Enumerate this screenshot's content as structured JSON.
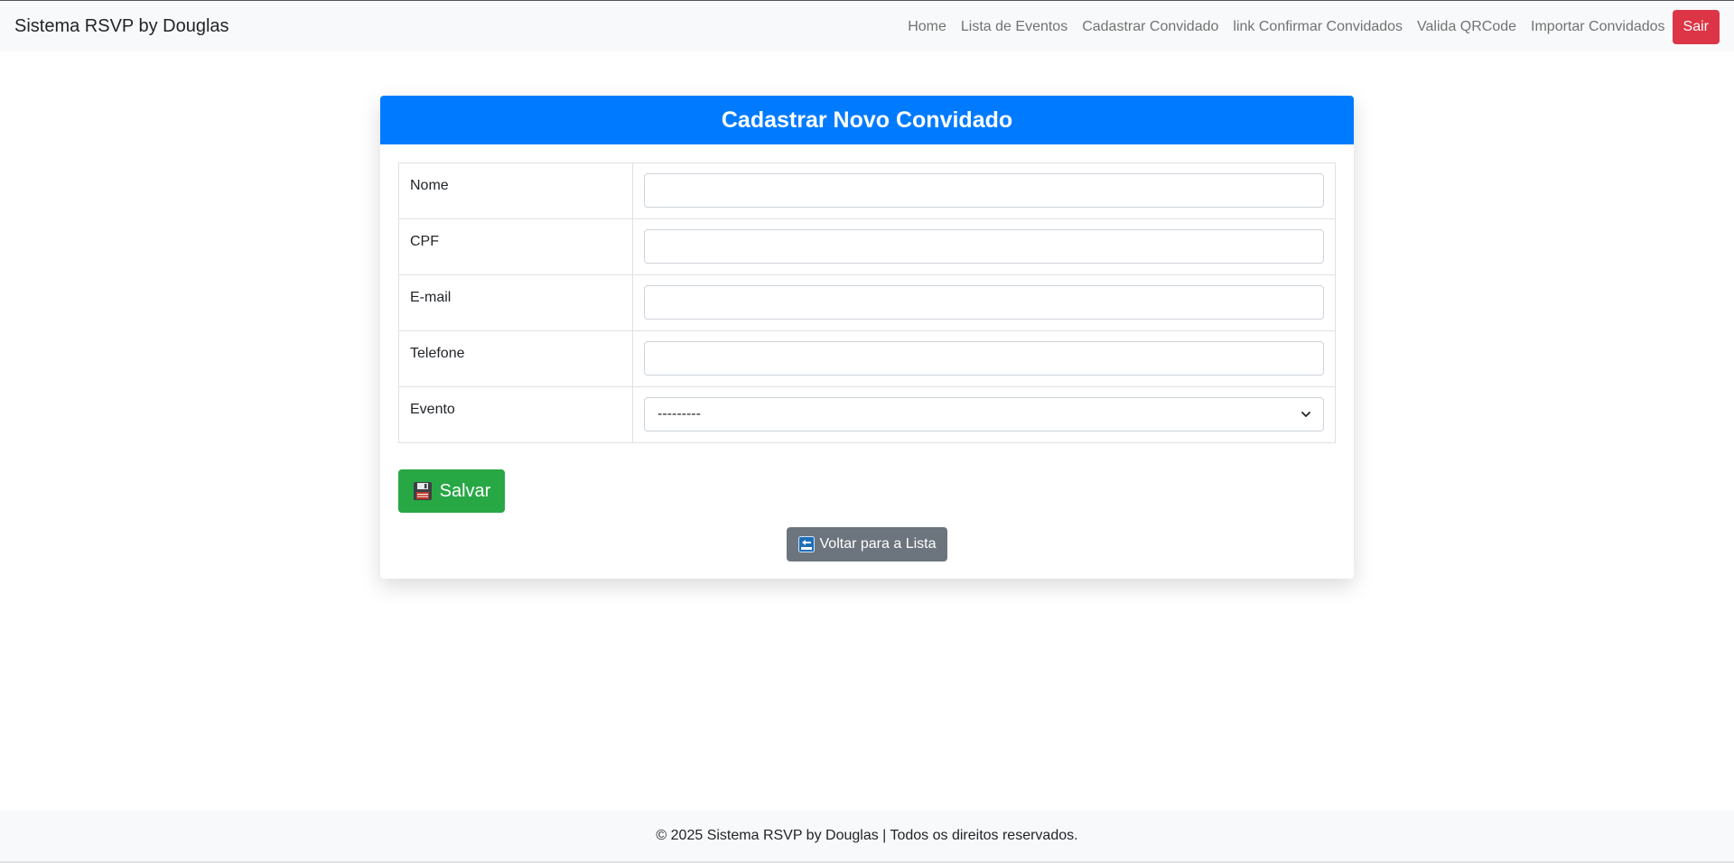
{
  "navbar": {
    "brand": "Sistema RSVP by Douglas",
    "links": [
      "Home",
      "Lista de Eventos",
      "Cadastrar Convidado",
      "link Confirmar Convidados",
      "Valida QRCode",
      "Importar Convidados"
    ],
    "logout": "Sair"
  },
  "form": {
    "title": "Cadastrar Novo Convidado",
    "fields": [
      {
        "label": "Nome",
        "value": ""
      },
      {
        "label": "CPF",
        "value": ""
      },
      {
        "label": "E-mail",
        "value": ""
      },
      {
        "label": "Telefone",
        "value": ""
      },
      {
        "label": "Evento",
        "selected": "---------"
      }
    ],
    "save_label": "Salvar",
    "back_label": "Voltar para a Lista"
  },
  "icons": {
    "save": "floppy-disk-icon",
    "back": "back-arrow-icon"
  },
  "colors": {
    "primary": "#007bff",
    "success": "#28a745",
    "secondary": "#6c757d",
    "danger": "#dc3545"
  },
  "footer": {
    "text": "© 2025 Sistema RSVP by Douglas | Todos os direitos reservados."
  }
}
